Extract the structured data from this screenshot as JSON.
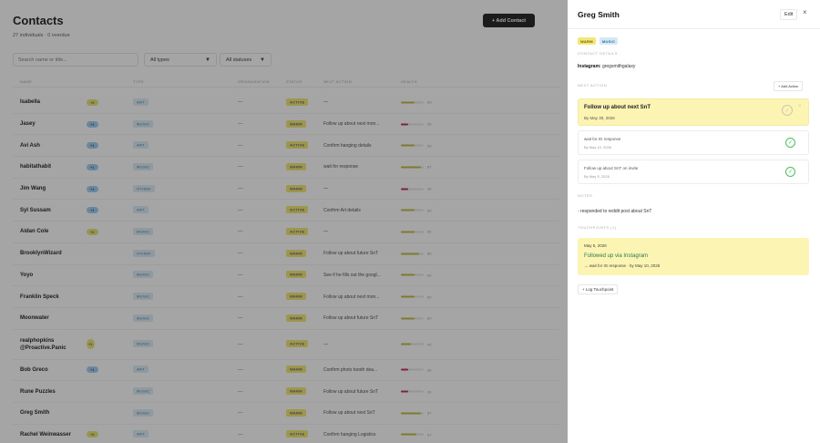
{
  "header": {
    "title": "Contacts",
    "subtitle": "27 individuals · 0 overdue",
    "add_contact_label": "+ Add Contact"
  },
  "filters": {
    "search_placeholder": "Search name or title...",
    "types_label": "All types",
    "statuses_label": "All statuses"
  },
  "table": {
    "columns": [
      "NAME",
      "TYPE",
      "ORGANIZATION",
      "STATUS",
      "NEXT ACTION",
      "HEALTH"
    ],
    "rows": [
      {
        "name": "Isabella",
        "badge": "+2",
        "badge_color": "yellow",
        "type": "ART",
        "org": "—",
        "status": "ACTIVE",
        "next": "—",
        "health": 60,
        "health_color": "#b9b932"
      },
      {
        "name": "Jasey",
        "badge": "+1",
        "badge_color": "blue",
        "type": "MUSIC",
        "org": "—",
        "status": "WARM",
        "next": "Follow up about next mon...",
        "health": 30,
        "health_color": "#c2185b"
      },
      {
        "name": "Avi Ash",
        "badge": "+1",
        "badge_color": "blue",
        "type": "ART",
        "org": "—",
        "status": "ACTIVE",
        "next": "Confirm hanging details",
        "health": 60,
        "health_color": "#b9b932"
      },
      {
        "name": "habitathabit",
        "badge": "+1",
        "badge_color": "blue",
        "type": "MUSIC",
        "org": "—",
        "status": "WARM",
        "next": "wait for response",
        "health": 87,
        "health_color": "#b9b932"
      },
      {
        "name": "Jim Wang",
        "badge": "+1",
        "badge_color": "blue",
        "type": "OTHER",
        "org": "—",
        "status": "WARM",
        "next": "—",
        "health": 30,
        "health_color": "#c2185b"
      },
      {
        "name": "Syl Sussam",
        "badge": "+1",
        "badge_color": "blue",
        "type": "ART",
        "org": "—",
        "status": "ACTIVE",
        "next": "Confirm Art details",
        "health": 60,
        "health_color": "#b9b932"
      },
      {
        "name": "Aidan Cole",
        "badge": "+2",
        "badge_color": "yellow",
        "type": "MUSIC",
        "org": "—",
        "status": "ACTIVE",
        "next": "—",
        "health": 60,
        "health_color": "#b9b932"
      },
      {
        "name": "BrooklynWizard",
        "badge": "",
        "badge_color": "",
        "type": "OTHER",
        "org": "—",
        "status": "WARM",
        "next": "Follow up about future SnT",
        "health": 80,
        "health_color": "#b9b932"
      },
      {
        "name": "Yoyo",
        "badge": "",
        "badge_color": "",
        "type": "MUSIC",
        "org": "—",
        "status": "WARM",
        "next": "See if he fills out the googl...",
        "health": 60,
        "health_color": "#b9b932"
      },
      {
        "name": "Franklin Speck",
        "badge": "",
        "badge_color": "",
        "type": "MUSIC",
        "org": "—",
        "status": "WARM",
        "next": "Follow up about next mon...",
        "health": 60,
        "health_color": "#b9b932"
      },
      {
        "name": "Moonwater",
        "badge": "",
        "badge_color": "",
        "type": "MUSIC",
        "org": "—",
        "status": "WARM",
        "next": "Follow up about future SnT",
        "health": 60,
        "health_color": "#b9b932"
      },
      {
        "name": "realphopkins @Proactive.Panic",
        "badge": "+1",
        "badge_color": "yellow",
        "type": "MUSIC",
        "org": "—",
        "status": "ACTIVE",
        "next": "—",
        "health": 45,
        "health_color": "#b9b932",
        "tall": true
      },
      {
        "name": "Bob Greco",
        "badge": "+1",
        "badge_color": "blue",
        "type": "ART",
        "org": "—",
        "status": "WARM",
        "next": "Confirm photo booth dea...",
        "health": 30,
        "health_color": "#c2185b"
      },
      {
        "name": "Rune Puzzles",
        "badge": "",
        "badge_color": "",
        "type": "MUSIC",
        "org": "—",
        "status": "WARM",
        "next": "Follow up about future SnT",
        "health": 30,
        "health_color": "#c2185b"
      },
      {
        "name": "Greg Smith",
        "badge": "",
        "badge_color": "",
        "type": "MUSIC",
        "org": "—",
        "status": "WARM",
        "next": "Follow up about next SnT",
        "health": 87,
        "health_color": "#b9b932"
      },
      {
        "name": "Rachel Weinwasser",
        "badge": "+2",
        "badge_color": "yellow",
        "type": "ART",
        "org": "—",
        "status": "ACTIVE",
        "next": "Confirm hanging Logistics",
        "health": 67,
        "health_color": "#b9b932"
      }
    ]
  },
  "panel": {
    "title": "Greg Smith",
    "edit_label": "Edit",
    "close_glyph": "×",
    "tags": [
      {
        "label": "WARM",
        "color": "yellow"
      },
      {
        "label": "MUSIC",
        "color": "blue"
      }
    ],
    "contact_details_label": "CONTACT DETAILS",
    "instagram_key": "Instagram:",
    "instagram_value": "gregsmithgalaxy",
    "next_action_label": "NEXT ACTION",
    "add_action_label": "+ Add Action",
    "actions": [
      {
        "title": "Follow up about next SnT",
        "date": "By May 30, 2026",
        "active": true
      },
      {
        "title": "wait for IG response",
        "date": "By May 10, 2026",
        "active": false
      },
      {
        "title": "Follow up about SnT on invite",
        "date": "By May 5, 2026",
        "active": false
      }
    ],
    "notes_label": "NOTES",
    "notes_text": "- responded to reddit post about SnT",
    "touchpoints_label": "TOUCHPOINTS (1)",
    "touchpoint": {
      "date": "May 5, 2026",
      "title": "Followed up via Instagram",
      "sub": "→ wait for IG response · by May 10, 2026"
    },
    "log_touchpoint_label": "+ Log Touchpoint"
  },
  "icons": {
    "check": "✓",
    "chevron_down": "▼"
  }
}
